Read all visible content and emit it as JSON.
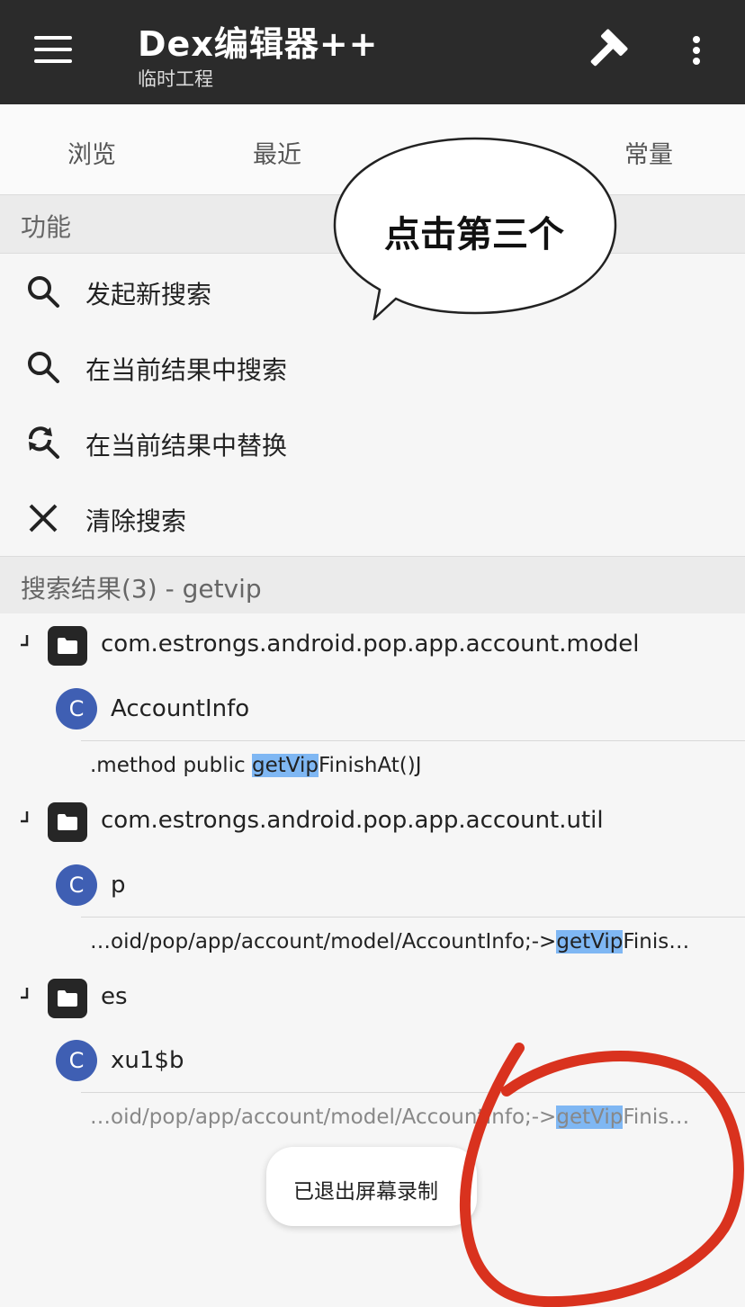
{
  "appbar": {
    "title": "Dex编辑器++",
    "subtitle": "临时工程",
    "bg_color": "#2b2b2b"
  },
  "tabs": [
    {
      "label": "浏览"
    },
    {
      "label": "最近"
    },
    {
      "label": "常量"
    }
  ],
  "functions_section": {
    "header": "功能",
    "items": [
      {
        "label": "发起新搜索",
        "icon": "search-icon"
      },
      {
        "label": "在当前结果中搜索",
        "icon": "search-icon"
      },
      {
        "label": "在当前结果中替换",
        "icon": "search-replace-icon"
      },
      {
        "label": "清除搜索",
        "icon": "close-icon"
      }
    ]
  },
  "results_section": {
    "header": "搜索结果(3) - getvip",
    "groups": [
      {
        "package": "com.estrongs.android.pop.app.account.model",
        "class_letter": "C",
        "class_name": "AccountInfo",
        "match_prefix": ".method public ",
        "match_hl": "getVip",
        "match_suffix": "FinishAt()J"
      },
      {
        "package": "com.estrongs.android.pop.app.account.util",
        "class_letter": "C",
        "class_name": "p",
        "match_prefix": "…oid/pop/app/account/model/AccountInfo;->",
        "match_hl": "getVip",
        "match_suffix": "Finis…"
      },
      {
        "package": "es",
        "class_letter": "C",
        "class_name": "xu1$b",
        "match_prefix": "…oid/pop/app/account/model/AccountInfo;->",
        "match_hl": "getVip",
        "match_suffix": "Finis…"
      }
    ]
  },
  "callout": {
    "text": "点击第三个"
  },
  "toast": {
    "text": "已退出屏幕录制"
  },
  "colors": {
    "accent_highlight": "#7fb7f3",
    "class_badge": "#3f5fb3",
    "annotation_red": "#d9321e"
  }
}
